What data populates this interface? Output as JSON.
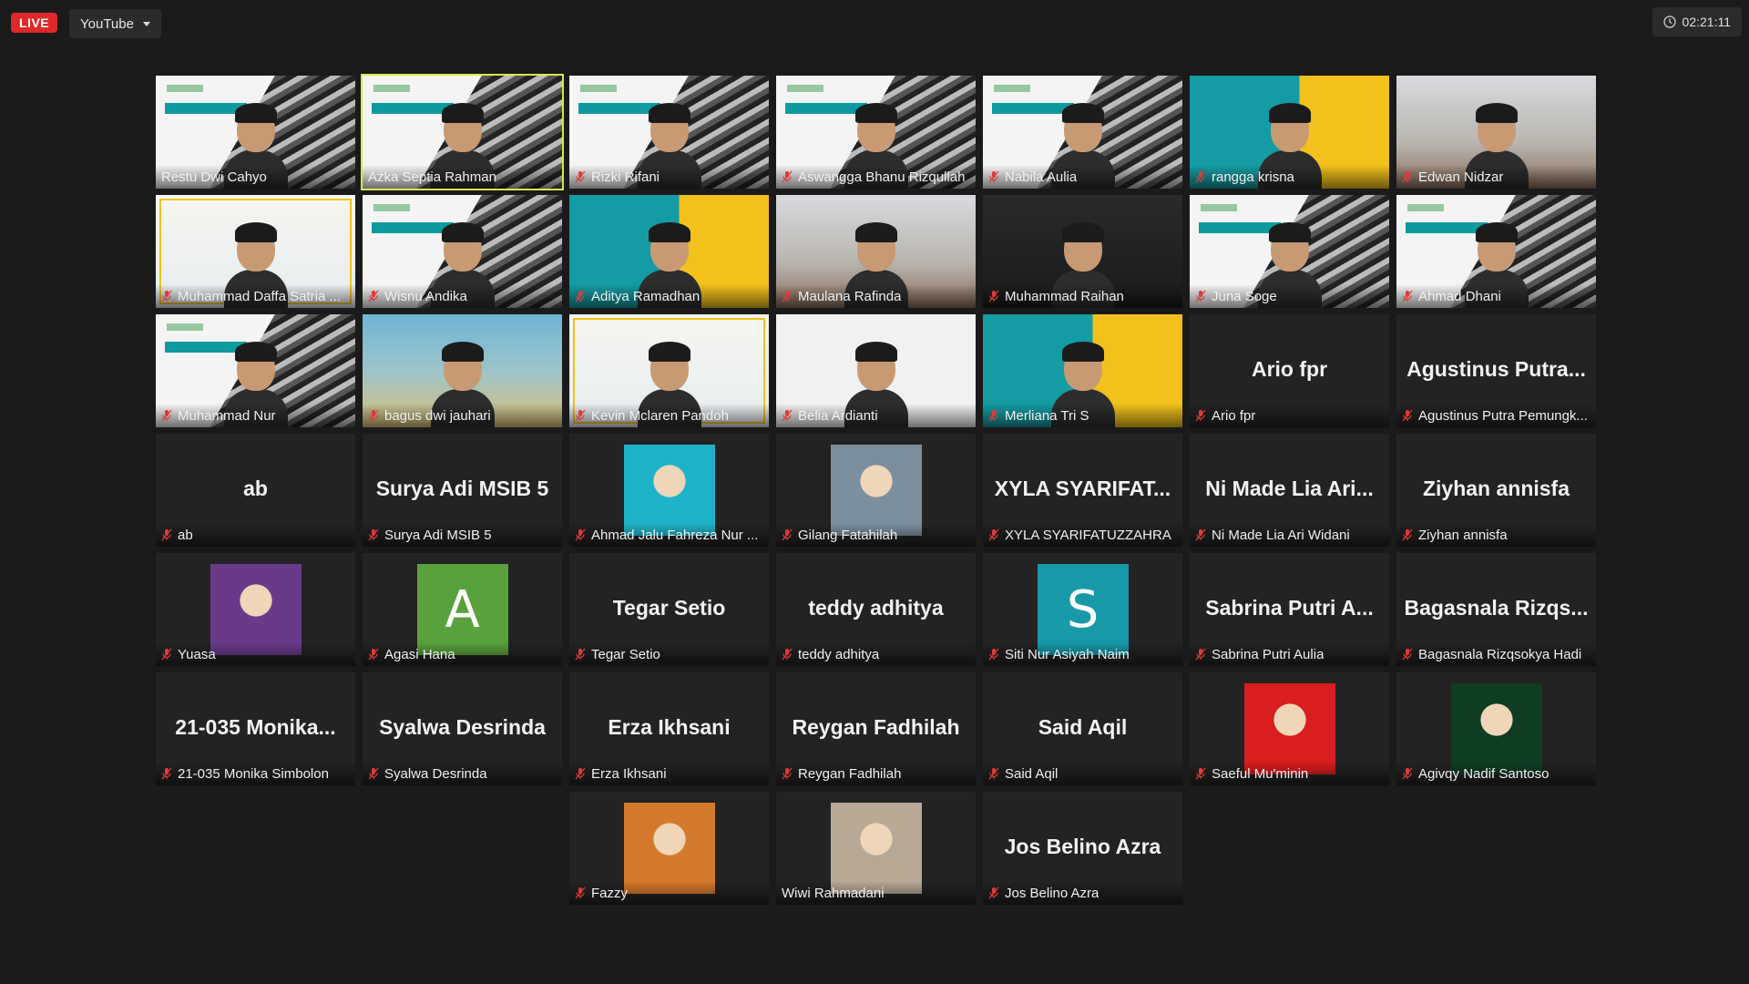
{
  "topbar": {
    "live_label": "LIVE",
    "platform_label": "YouTube",
    "timer": "02:21:11"
  },
  "participants": [
    {
      "name": "Restu Dwi Cahyo",
      "muted": false,
      "kind": "video",
      "bg": "fswd"
    },
    {
      "name": "Azka Septia Rahman",
      "muted": false,
      "kind": "video",
      "bg": "fswd",
      "active": true
    },
    {
      "name": "Rizki Rifani",
      "muted": true,
      "kind": "video",
      "bg": "fswd"
    },
    {
      "name": "Aswangga Bhanu Rizqullah",
      "muted": true,
      "kind": "video",
      "bg": "fswd"
    },
    {
      "name": "Nabila Aulia",
      "muted": true,
      "kind": "video",
      "bg": "fswd"
    },
    {
      "name": "rangga krisna",
      "muted": true,
      "kind": "video",
      "bg": "studi"
    },
    {
      "name": "Edwan Nidzar",
      "muted": true,
      "kind": "video",
      "bg": "room"
    },
    {
      "name": "Muhammad Daffa Satria ...",
      "muted": true,
      "kind": "video",
      "bg": "bukan"
    },
    {
      "name": "Wisnu Andika",
      "muted": true,
      "kind": "video",
      "bg": "fswd"
    },
    {
      "name": "Aditya Ramadhan",
      "muted": true,
      "kind": "video",
      "bg": "studi"
    },
    {
      "name": "Maulana Rafinda",
      "muted": true,
      "kind": "video",
      "bg": "room"
    },
    {
      "name": "Muhammad Raihan",
      "muted": true,
      "kind": "video",
      "bg": "dark"
    },
    {
      "name": "Juna Soge",
      "muted": true,
      "kind": "video",
      "bg": "fswd"
    },
    {
      "name": "Ahmad Dhani",
      "muted": true,
      "kind": "video",
      "bg": "fswd"
    },
    {
      "name": "Muhammad Nur",
      "muted": true,
      "kind": "video",
      "bg": "fswd"
    },
    {
      "name": "bagus dwi jauhari",
      "muted": true,
      "kind": "video",
      "bg": "sponge"
    },
    {
      "name": "Kevin Mclaren Pandoh",
      "muted": true,
      "kind": "video",
      "bg": "bukan"
    },
    {
      "name": "Belia Ardianti",
      "muted": true,
      "kind": "video",
      "bg": "white"
    },
    {
      "name": "Merliana Tri S",
      "muted": true,
      "kind": "video",
      "bg": "studi"
    },
    {
      "name": "Ario fpr",
      "muted": true,
      "kind": "name",
      "display": "Ario fpr"
    },
    {
      "name": "Agustinus Putra Pemungk...",
      "muted": true,
      "kind": "name",
      "display": "Agustinus Putra..."
    },
    {
      "name": "ab",
      "muted": true,
      "kind": "name",
      "display": "ab"
    },
    {
      "name": "Surya Adi MSIB 5",
      "muted": true,
      "kind": "name",
      "display": "Surya Adi MSIB 5"
    },
    {
      "name": "Ahmad Jalu Fahreza Nur ...",
      "muted": true,
      "kind": "avatar",
      "color": "#1fb3c9"
    },
    {
      "name": "Gilang Fatahilah",
      "muted": true,
      "kind": "avatar",
      "color": "#7d8f9e"
    },
    {
      "name": "XYLA SYARIFATUZZAHRA",
      "muted": true,
      "kind": "name",
      "display": "XYLA SYARIFAT..."
    },
    {
      "name": "Ni Made Lia Ari Widani",
      "muted": true,
      "kind": "name",
      "display": "Ni Made Lia Ari..."
    },
    {
      "name": "Ziyhan annisfa",
      "muted": true,
      "kind": "name",
      "display": "Ziyhan annisfa"
    },
    {
      "name": "Yuasa",
      "muted": true,
      "kind": "avatar",
      "color": "#6a3a8a"
    },
    {
      "name": "Agasi Hana",
      "muted": true,
      "kind": "letter",
      "letter": "A",
      "color": "#58a13c"
    },
    {
      "name": "Tegar Setio",
      "muted": true,
      "kind": "name",
      "display": "Tegar Setio"
    },
    {
      "name": "teddy adhitya",
      "muted": true,
      "kind": "name",
      "display": "teddy adhitya"
    },
    {
      "name": "Siti Nur Asiyah Naim",
      "muted": true,
      "kind": "letter",
      "letter": "S",
      "color": "#1799a8"
    },
    {
      "name": "Sabrina Putri Aulia",
      "muted": true,
      "kind": "name",
      "display": "Sabrina Putri A..."
    },
    {
      "name": "Bagasnala Rizqsokya Hadi",
      "muted": true,
      "kind": "name",
      "display": "Bagasnala Rizqs..."
    },
    {
      "name": "21-035 Monika Simbolon",
      "muted": true,
      "kind": "name",
      "display": "21-035 Monika..."
    },
    {
      "name": "Syalwa Desrinda",
      "muted": true,
      "kind": "name",
      "display": "Syalwa Desrinda"
    },
    {
      "name": "Erza Ikhsani",
      "muted": true,
      "kind": "name",
      "display": "Erza Ikhsani"
    },
    {
      "name": "Reygan Fadhilah",
      "muted": true,
      "kind": "name",
      "display": "Reygan Fadhilah"
    },
    {
      "name": "Said Aqil",
      "muted": true,
      "kind": "name",
      "display": "Said Aqil"
    },
    {
      "name": "Saeful Mu'minin",
      "muted": true,
      "kind": "avatar",
      "color": "#d81e1e"
    },
    {
      "name": "Agivqy Nadif Santoso",
      "muted": true,
      "kind": "avatar",
      "color": "#0e3d22"
    },
    {
      "name": "Fazzy",
      "muted": true,
      "kind": "avatar",
      "color": "#d57a2c"
    },
    {
      "name": "Wiwi Rahmadani",
      "muted": false,
      "kind": "avatar",
      "color": "#b8a996"
    },
    {
      "name": "Jos Belino Azra",
      "muted": true,
      "kind": "name",
      "display": "Jos Belino Azra"
    }
  ]
}
